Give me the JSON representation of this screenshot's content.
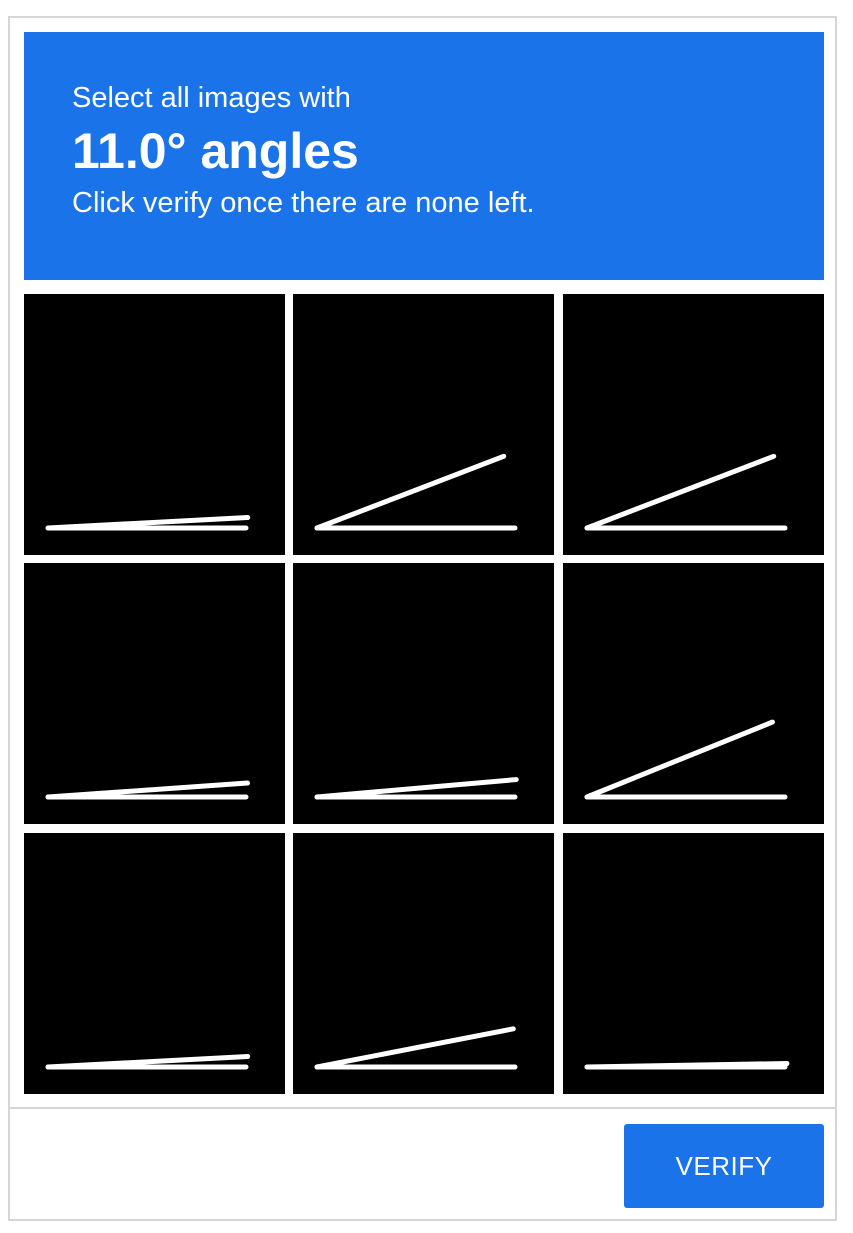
{
  "header": {
    "line1": "Select all images with",
    "line2": "11.0° angles",
    "line3": "Click verify once there are none left."
  },
  "tiles": [
    {
      "angle_deg": 3
    },
    {
      "angle_deg": 21
    },
    {
      "angle_deg": 21
    },
    {
      "angle_deg": 4
    },
    {
      "angle_deg": 5
    },
    {
      "angle_deg": 22
    },
    {
      "angle_deg": 3
    },
    {
      "angle_deg": 11
    },
    {
      "angle_deg": 1
    }
  ],
  "verify_label": "VERIFY",
  "colors": {
    "accent": "#1a73e8",
    "tile_bg": "#000000",
    "stroke": "#ffffff"
  }
}
